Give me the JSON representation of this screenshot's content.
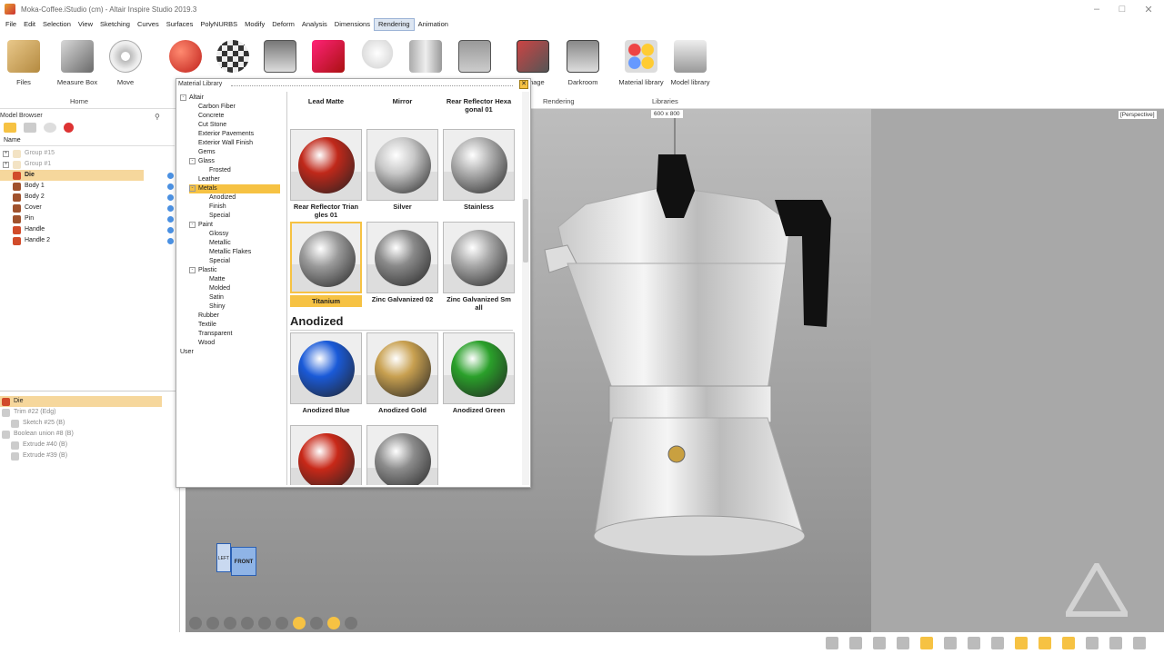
{
  "window": {
    "title": "Moka-Coffee.iStudio (cm) - Altair Inspire Studio 2019.3"
  },
  "menu": [
    "File",
    "Edit",
    "Selection",
    "View",
    "Sketching",
    "Curves",
    "Surfaces",
    "PolyNURBS",
    "Modify",
    "Deform",
    "Analysis",
    "Dimensions",
    "Rendering",
    "Animation"
  ],
  "ribbon": {
    "files": "Files",
    "measure_box": "Measure Box",
    "move": "Move",
    "home_group": "Home",
    "render_image": "r Image",
    "darkroom": "Darkroom",
    "rendering_group": "Rendering",
    "material_library": "Material library",
    "model_library": "Model library",
    "libraries_group": "Libraries"
  },
  "model_browser": {
    "title": "Model Browser",
    "name_col": "Name",
    "items": [
      {
        "label": "Group #15",
        "faded": true
      },
      {
        "label": "Group #1",
        "faded": true
      },
      {
        "label": "Die",
        "selected": true
      },
      {
        "label": "Body 1"
      },
      {
        "label": "Body 2"
      },
      {
        "label": "Cover"
      },
      {
        "label": "Pin"
      },
      {
        "label": "Handle"
      },
      {
        "label": "Handle 2"
      }
    ],
    "history": [
      {
        "label": "Die"
      },
      {
        "label": "Trim #22 (Edg)"
      },
      {
        "label": "Sketch #25 (B)"
      },
      {
        "label": "Boolean union #8 (B)"
      },
      {
        "label": "Extrude #40 (B)"
      },
      {
        "label": "Extrude #39 (B)"
      }
    ]
  },
  "library": {
    "title": "Material Library",
    "tree": [
      {
        "label": "Altair",
        "depth": 0,
        "pm": "-"
      },
      {
        "label": "Carbon Fiber",
        "depth": 1
      },
      {
        "label": "Concrete",
        "depth": 1
      },
      {
        "label": "Cut Stone",
        "depth": 1
      },
      {
        "label": "Exterior Pavements",
        "depth": 1
      },
      {
        "label": "Exterior Wall Finish",
        "depth": 1
      },
      {
        "label": "Gems",
        "depth": 1
      },
      {
        "label": "Glass",
        "depth": 1,
        "pm": "-"
      },
      {
        "label": "Frosted",
        "depth": 2
      },
      {
        "label": "Leather",
        "depth": 1
      },
      {
        "label": "Metals",
        "depth": 1,
        "pm": "-",
        "selected": true
      },
      {
        "label": "Anodized",
        "depth": 2
      },
      {
        "label": "Finish",
        "depth": 2
      },
      {
        "label": "Special",
        "depth": 2
      },
      {
        "label": "Paint",
        "depth": 1,
        "pm": "-"
      },
      {
        "label": "Glossy",
        "depth": 2
      },
      {
        "label": "Metallic",
        "depth": 2
      },
      {
        "label": "Metallic Flakes",
        "depth": 2
      },
      {
        "label": "Special",
        "depth": 2
      },
      {
        "label": "Plastic",
        "depth": 1,
        "pm": "-"
      },
      {
        "label": "Matte",
        "depth": 2
      },
      {
        "label": "Molded",
        "depth": 2
      },
      {
        "label": "Satin",
        "depth": 2
      },
      {
        "label": "Shiny",
        "depth": 2
      },
      {
        "label": "Rubber",
        "depth": 1
      },
      {
        "label": "Textile",
        "depth": 1
      },
      {
        "label": "Transparent",
        "depth": 1
      },
      {
        "label": "Wood",
        "depth": 1
      },
      {
        "label": "User",
        "depth": 0
      }
    ],
    "top_labels": [
      "Lead Matte",
      "Mirror",
      "Rear Reflector Hexa gonal 01"
    ],
    "materials": [
      {
        "label": "Rear Reflector Trian gles 01",
        "color": "#c0281a"
      },
      {
        "label": "Silver",
        "color": "#c8c8c8"
      },
      {
        "label": "Stainless",
        "color": "#b0b0b0"
      },
      {
        "label": "Titanium",
        "color": "#9a9a9a",
        "selected": true
      },
      {
        "label": "Zinc Galvanized 02",
        "color": "#8a8a8a"
      },
      {
        "label": "Zinc Galvanized Sm all",
        "color": "#a8a8a8"
      }
    ],
    "section": "Anodized",
    "anodized": [
      {
        "label": "Anodized Blue",
        "color": "#1a5ad8"
      },
      {
        "label": "Anodized Gold",
        "color": "#c8a050"
      },
      {
        "label": "Anodized Green",
        "color": "#2aa02a"
      },
      {
        "label": "",
        "color": "#c82818"
      },
      {
        "label": "",
        "color": "#8c8c8c"
      }
    ]
  },
  "viewport": {
    "size_label": "600 x 800",
    "view_label": "[Perspective]",
    "cube_left": "LEFT",
    "cube_front": "FRONT"
  }
}
